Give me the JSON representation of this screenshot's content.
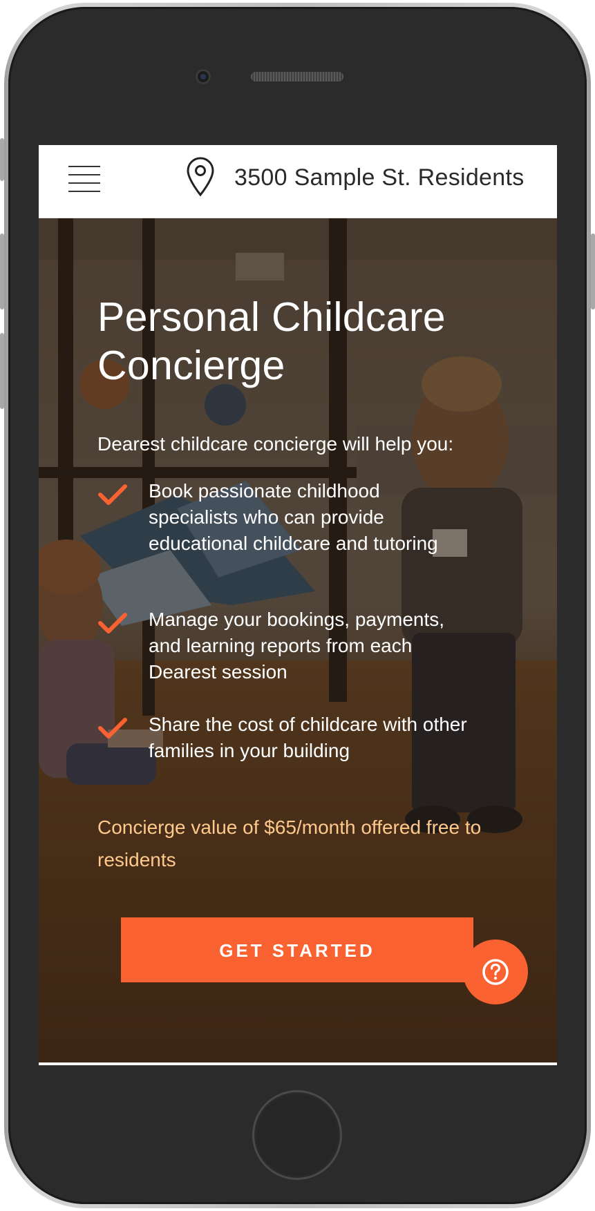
{
  "device": {
    "frame": "smartphone"
  },
  "header": {
    "menu_icon": "hamburger-menu-icon",
    "location_icon": "map-pin-icon",
    "location_label": "3500 Sample St. Residents"
  },
  "hero": {
    "title": "Personal Childcare Concierge",
    "intro": "Dearest childcare concierge will help you:",
    "benefits": [
      {
        "icon": "checkmark-icon",
        "text": "Book passionate childhood specialists who can provide educational childcare and tutoring"
      },
      {
        "icon": "checkmark-icon",
        "text": "Manage your bookings, payments, and learning reports from each Dearest session"
      },
      {
        "icon": "checkmark-icon",
        "text": "Share the cost of childcare with other families in your building"
      }
    ],
    "offer": "Concierge value of $65/month offered free to residents",
    "cta_label": "GET STARTED",
    "help_icon": "question-mark-icon"
  },
  "colors": {
    "accent": "#fb6231",
    "offer_text": "#ffc98c",
    "header_bg": "#ffffff",
    "text_dark": "#2a2a2a"
  }
}
